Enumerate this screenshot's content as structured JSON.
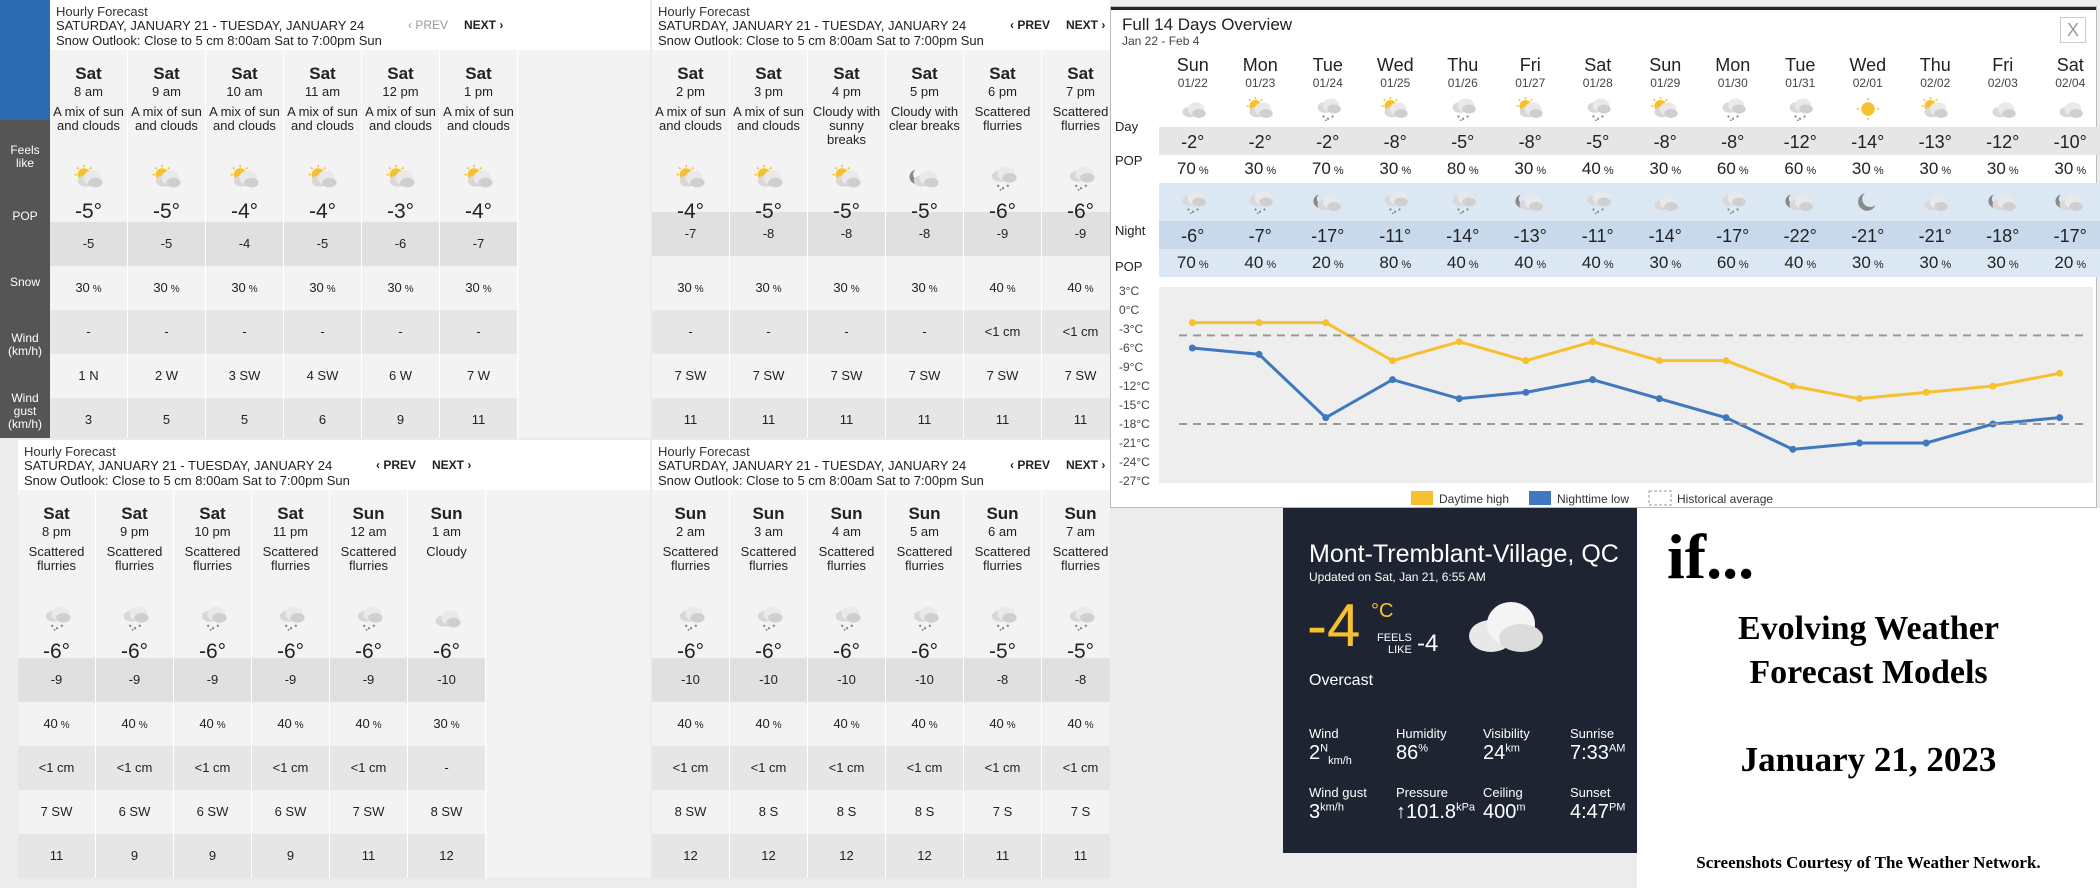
{
  "hourly_common": {
    "title": "Hourly Forecast",
    "dates": "SATURDAY, JANUARY 21 - TUESDAY, JANUARY 24",
    "snow_outlook": "Snow Outlook: Close to 5 cm 8:00am Sat to 7:00pm Sun",
    "prev": "‹ PREV",
    "next": "NEXT ›"
  },
  "row_labels": {
    "feels": "Feels like",
    "pop": "POP",
    "snow": "Snow",
    "wind": "Wind (km/h)",
    "gust": "Wind gust (km/h)"
  },
  "panel1": [
    {
      "day": "Sat",
      "hour": "8 am",
      "cond": "A mix of sun and clouds",
      "icon": "sun-cloud-icon",
      "temp": "-5°",
      "feels": "-5",
      "pop": "30",
      "snow": "-",
      "wind": "1 N",
      "gust": "3"
    },
    {
      "day": "Sat",
      "hour": "9 am",
      "cond": "A mix of sun and clouds",
      "icon": "sun-cloud-icon",
      "temp": "-5°",
      "feels": "-5",
      "pop": "30",
      "snow": "-",
      "wind": "2 W",
      "gust": "5"
    },
    {
      "day": "Sat",
      "hour": "10 am",
      "cond": "A mix of sun and clouds",
      "icon": "sun-cloud-icon",
      "temp": "-4°",
      "feels": "-4",
      "pop": "30",
      "snow": "-",
      "wind": "3 SW",
      "gust": "5"
    },
    {
      "day": "Sat",
      "hour": "11 am",
      "cond": "A mix of sun and clouds",
      "icon": "sun-cloud-icon",
      "temp": "-4°",
      "feels": "-5",
      "pop": "30",
      "snow": "-",
      "wind": "4 SW",
      "gust": "6"
    },
    {
      "day": "Sat",
      "hour": "12 pm",
      "cond": "A mix of sun and clouds",
      "icon": "sun-cloud-icon",
      "temp": "-3°",
      "feels": "-6",
      "pop": "30",
      "snow": "-",
      "wind": "6 W",
      "gust": "9"
    },
    {
      "day": "Sat",
      "hour": "1 pm",
      "cond": "A mix of sun and clouds",
      "icon": "sun-cloud-icon",
      "temp": "-4°",
      "feels": "-7",
      "pop": "30",
      "snow": "-",
      "wind": "7 W",
      "gust": "11"
    }
  ],
  "panel2": [
    {
      "day": "Sat",
      "hour": "2 pm",
      "cond": "A mix of sun and clouds",
      "icon": "sun-cloud-icon",
      "temp": "-4°",
      "feels": "-7",
      "pop": "30",
      "snow": "-",
      "wind": "7 SW",
      "gust": "11"
    },
    {
      "day": "Sat",
      "hour": "3 pm",
      "cond": "A mix of sun and clouds",
      "icon": "sun-cloud-icon",
      "temp": "-5°",
      "feels": "-8",
      "pop": "30",
      "snow": "-",
      "wind": "7 SW",
      "gust": "11"
    },
    {
      "day": "Sat",
      "hour": "4 pm",
      "cond": "Cloudy with sunny breaks",
      "icon": "sun-cloud-icon",
      "temp": "-5°",
      "feels": "-8",
      "pop": "30",
      "snow": "-",
      "wind": "7 SW",
      "gust": "11"
    },
    {
      "day": "Sat",
      "hour": "5 pm",
      "cond": "Cloudy with clear breaks",
      "icon": "moon-cloud-icon",
      "temp": "-5°",
      "feels": "-8",
      "pop": "30",
      "snow": "-",
      "wind": "7 SW",
      "gust": "11"
    },
    {
      "day": "Sat",
      "hour": "6 pm",
      "cond": "Scattered flurries",
      "icon": "flurries-icon",
      "temp": "-6°",
      "feels": "-9",
      "pop": "40",
      "snow": "<1 cm",
      "wind": "7 SW",
      "gust": "11"
    },
    {
      "day": "Sat",
      "hour": "7 pm",
      "cond": "Scattered flurries",
      "icon": "flurries-icon",
      "temp": "-6°",
      "feels": "-9",
      "pop": "40",
      "snow": "<1 cm",
      "wind": "7 SW",
      "gust": "11"
    }
  ],
  "panel3": [
    {
      "day": "Sat",
      "hour": "8 pm",
      "cond": "Scattered flurries",
      "icon": "flurries-icon",
      "temp": "-6°",
      "feels": "-9",
      "pop": "40",
      "snow": "<1 cm",
      "wind": "7 SW",
      "gust": "11"
    },
    {
      "day": "Sat",
      "hour": "9 pm",
      "cond": "Scattered flurries",
      "icon": "flurries-icon",
      "temp": "-6°",
      "feels": "-9",
      "pop": "40",
      "snow": "<1 cm",
      "wind": "6 SW",
      "gust": "9"
    },
    {
      "day": "Sat",
      "hour": "10 pm",
      "cond": "Scattered flurries",
      "icon": "flurries-icon",
      "temp": "-6°",
      "feels": "-9",
      "pop": "40",
      "snow": "<1 cm",
      "wind": "6 SW",
      "gust": "9"
    },
    {
      "day": "Sat",
      "hour": "11 pm",
      "cond": "Scattered flurries",
      "icon": "flurries-icon",
      "temp": "-6°",
      "feels": "-9",
      "pop": "40",
      "snow": "<1 cm",
      "wind": "6 SW",
      "gust": "9"
    },
    {
      "day": "Sun",
      "hour": "12 am",
      "cond": "Scattered flurries",
      "icon": "flurries-icon",
      "temp": "-6°",
      "feels": "-9",
      "pop": "40",
      "snow": "<1 cm",
      "wind": "7 SW",
      "gust": "11"
    },
    {
      "day": "Sun",
      "hour": "1 am",
      "cond": "Cloudy",
      "icon": "cloud-icon",
      "temp": "-6°",
      "feels": "-10",
      "pop": "30",
      "snow": "-",
      "wind": "8 SW",
      "gust": "12"
    }
  ],
  "panel4": [
    {
      "day": "Sun",
      "hour": "2 am",
      "cond": "Scattered flurries",
      "icon": "flurries-icon",
      "temp": "-6°",
      "feels": "-10",
      "pop": "40",
      "snow": "<1 cm",
      "wind": "8 SW",
      "gust": "12"
    },
    {
      "day": "Sun",
      "hour": "3 am",
      "cond": "Scattered flurries",
      "icon": "flurries-icon",
      "temp": "-6°",
      "feels": "-10",
      "pop": "40",
      "snow": "<1 cm",
      "wind": "8 S",
      "gust": "12"
    },
    {
      "day": "Sun",
      "hour": "4 am",
      "cond": "Scattered flurries",
      "icon": "flurries-icon",
      "temp": "-6°",
      "feels": "-10",
      "pop": "40",
      "snow": "<1 cm",
      "wind": "8 S",
      "gust": "12"
    },
    {
      "day": "Sun",
      "hour": "5 am",
      "cond": "Scattered flurries",
      "icon": "flurries-icon",
      "temp": "-6°",
      "feels": "-10",
      "pop": "40",
      "snow": "<1 cm",
      "wind": "8 S",
      "gust": "12"
    },
    {
      "day": "Sun",
      "hour": "6 am",
      "cond": "Scattered flurries",
      "icon": "flurries-icon",
      "temp": "-5°",
      "feels": "-8",
      "pop": "40",
      "snow": "<1 cm",
      "wind": "7 S",
      "gust": "11"
    },
    {
      "day": "Sun",
      "hour": "7 am",
      "cond": "Scattered flurries",
      "icon": "flurries-icon",
      "temp": "-5°",
      "feels": "-8",
      "pop": "40",
      "snow": "<1 cm",
      "wind": "7 S",
      "gust": "11"
    }
  ],
  "overview": {
    "title": "Full 14 Days Overview",
    "subtitle": "Jan 22 - Feb 4",
    "close": "X",
    "day_label": "Day",
    "night_label": "Night",
    "pop_label": "POP",
    "days": [
      {
        "name": "Sun",
        "date": "01/22",
        "hi": "-2°",
        "dpop": "70",
        "dicon": "cloud-icon",
        "lo": "-6°",
        "npop": "70",
        "nicon": "flurries-icon"
      },
      {
        "name": "Mon",
        "date": "01/23",
        "hi": "-2°",
        "dpop": "30",
        "dicon": "sun-cloud-icon",
        "lo": "-7°",
        "npop": "40",
        "nicon": "flurries-icon"
      },
      {
        "name": "Tue",
        "date": "01/24",
        "hi": "-2°",
        "dpop": "70",
        "dicon": "flurries-icon",
        "lo": "-17°",
        "npop": "20",
        "nicon": "moon-cloud-icon"
      },
      {
        "name": "Wed",
        "date": "01/25",
        "hi": "-8°",
        "dpop": "30",
        "dicon": "sun-cloud-icon",
        "lo": "-11°",
        "npop": "80",
        "nicon": "flurries-icon"
      },
      {
        "name": "Thu",
        "date": "01/26",
        "hi": "-5°",
        "dpop": "80",
        "dicon": "flurries-icon",
        "lo": "-14°",
        "npop": "40",
        "nicon": "flurries-icon"
      },
      {
        "name": "Fri",
        "date": "01/27",
        "hi": "-8°",
        "dpop": "30",
        "dicon": "sun-cloud-icon",
        "lo": "-13°",
        "npop": "40",
        "nicon": "moon-cloud-icon"
      },
      {
        "name": "Sat",
        "date": "01/28",
        "hi": "-5°",
        "dpop": "40",
        "dicon": "flurries-icon",
        "lo": "-11°",
        "npop": "40",
        "nicon": "flurries-icon"
      },
      {
        "name": "Sun",
        "date": "01/29",
        "hi": "-8°",
        "dpop": "30",
        "dicon": "sun-cloud-icon",
        "lo": "-14°",
        "npop": "30",
        "nicon": "cloud-icon"
      },
      {
        "name": "Mon",
        "date": "01/30",
        "hi": "-8°",
        "dpop": "60",
        "dicon": "flurries-icon",
        "lo": "-17°",
        "npop": "60",
        "nicon": "flurries-icon"
      },
      {
        "name": "Tue",
        "date": "01/31",
        "hi": "-12°",
        "dpop": "60",
        "dicon": "flurries-icon",
        "lo": "-22°",
        "npop": "40",
        "nicon": "moon-cloud-icon"
      },
      {
        "name": "Wed",
        "date": "02/01",
        "hi": "-14°",
        "dpop": "30",
        "dicon": "sun-icon",
        "lo": "-21°",
        "npop": "30",
        "nicon": "moon-icon"
      },
      {
        "name": "Thu",
        "date": "02/02",
        "hi": "-13°",
        "dpop": "30",
        "dicon": "sun-cloud-icon",
        "lo": "-21°",
        "npop": "30",
        "nicon": "cloud-icon"
      },
      {
        "name": "Fri",
        "date": "02/03",
        "hi": "-12°",
        "dpop": "30",
        "dicon": "cloud-icon",
        "lo": "-18°",
        "npop": "30",
        "nicon": "moon-cloud-icon"
      },
      {
        "name": "Sat",
        "date": "02/04",
        "hi": "-10°",
        "dpop": "30",
        "dicon": "cloud-icon",
        "lo": "-17°",
        "npop": "20",
        "nicon": "moon-cloud-icon"
      }
    ]
  },
  "chart_data": {
    "type": "line",
    "x": [
      "01/22",
      "01/23",
      "01/24",
      "01/25",
      "01/26",
      "01/27",
      "01/28",
      "01/29",
      "01/30",
      "01/31",
      "02/01",
      "02/02",
      "02/03",
      "02/04"
    ],
    "series": [
      {
        "name": "Daytime high",
        "color": "#f6c02f",
        "values": [
          -2,
          -2,
          -2,
          -8,
          -5,
          -8,
          -5,
          -8,
          -8,
          -12,
          -14,
          -13,
          -12,
          -10
        ]
      },
      {
        "name": "Nighttime low",
        "color": "#3f78bf",
        "values": [
          -6,
          -7,
          -17,
          -11,
          -14,
          -13,
          -11,
          -14,
          -17,
          -22,
          -21,
          -21,
          -18,
          -17
        ]
      },
      {
        "name": "Historical average",
        "color": "#999999",
        "values": [
          -4,
          -4,
          -4,
          -4,
          -4,
          -4,
          -4,
          -4,
          -4,
          -4,
          -4,
          -4,
          -4,
          -4
        ]
      },
      {
        "name": "Historical average low",
        "color": "#999999",
        "values": [
          -18,
          -18,
          -18,
          -18,
          -18,
          -18,
          -18,
          -18,
          -18,
          -18,
          -18,
          -18,
          -18,
          -18
        ]
      }
    ],
    "yticks": [
      "3°C",
      "0°C",
      "-3°C",
      "-6°C",
      "-9°C",
      "-12°C",
      "-15°C",
      "-18°C",
      "-21°C",
      "-24°C",
      "-27°C"
    ],
    "ylim": [
      -27,
      3
    ],
    "legend": [
      "Daytime high",
      "Nighttime low",
      "Historical average"
    ],
    "legend_position": "bottom"
  },
  "current": {
    "location": "Mont-Tremblant-Village, QC",
    "updated": "Updated on Sat, Jan 21, 6:55 AM",
    "temp": "-4",
    "unit": "°C",
    "feels_label1": "FEELS",
    "feels_label2": "LIKE",
    "feels": "-4",
    "condition": "Overcast",
    "icon": "cloud-icon",
    "stats": [
      {
        "label": "Wind",
        "value": "2",
        "sup": "N",
        "sub": "km/h"
      },
      {
        "label": "Humidity",
        "value": "86",
        "sup": "%",
        "sub": ""
      },
      {
        "label": "Visibility",
        "value": "24",
        "sup": "km",
        "sub": ""
      },
      {
        "label": "Sunrise",
        "value": "7:33",
        "sup": "AM",
        "sub": ""
      },
      {
        "label": "Wind gust",
        "value": "3",
        "sup": "km/h",
        "sub": ""
      },
      {
        "label": "Pressure",
        "value": "↑101.8",
        "sup": "kPa",
        "sub": ""
      },
      {
        "label": "Ceiling",
        "value": "400",
        "sup": "m",
        "sub": ""
      },
      {
        "label": "Sunset",
        "value": "4:47",
        "sup": "PM",
        "sub": ""
      }
    ]
  },
  "caption": {
    "if": "if...",
    "line1": "Evolving Weather",
    "line2": "Forecast Models",
    "date": "January 21, 2023",
    "credit": "Screenshots Courtesy of The Weather Network."
  },
  "colors": {
    "daytime": "#f6c02f",
    "nighttime": "#3f78bf",
    "night_band": "#dbe8f3",
    "current_bg": "#1e2431",
    "temp_accent": "#f6c02f"
  }
}
